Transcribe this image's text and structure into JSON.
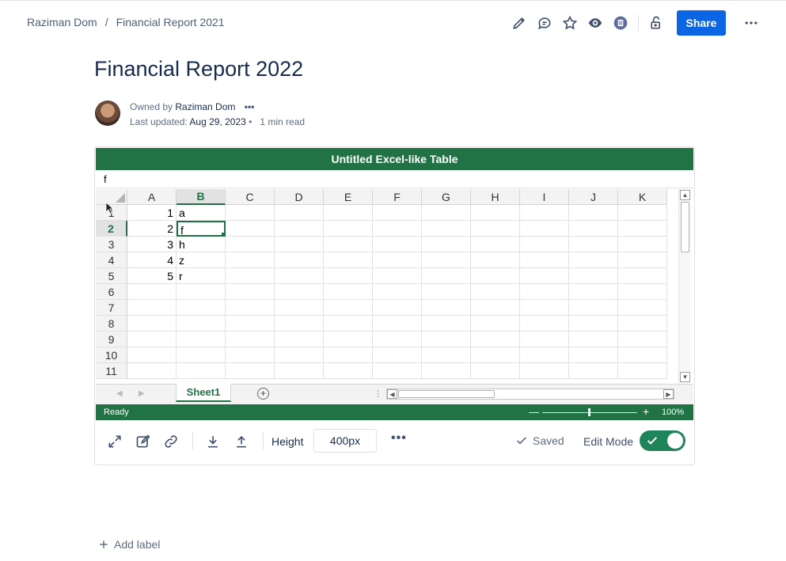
{
  "breadcrumb": {
    "parent": "Raziman Dom",
    "separator": "/",
    "current": "Financial Report 2021"
  },
  "header": {
    "share_label": "Share"
  },
  "page": {
    "title": "Financial Report 2022"
  },
  "byline": {
    "owned_prefix": "Owned by",
    "owner": "Raziman Dom",
    "owner_more": "•••",
    "updated_prefix": "Last updated:",
    "updated_date": "Aug 29, 2023",
    "dot": "•",
    "read_time": "1 min read"
  },
  "spreadsheet": {
    "title": "Untitled Excel-like Table",
    "formula_value": "f",
    "columns": [
      "A",
      "B",
      "C",
      "D",
      "E",
      "F",
      "G",
      "H",
      "I",
      "J",
      "K"
    ],
    "active_column": "B",
    "active_row": 2,
    "rows": [
      {
        "label": "1",
        "cells": [
          "1",
          "a",
          "",
          "",
          "",
          "",
          "",
          "",
          "",
          "",
          ""
        ]
      },
      {
        "label": "2",
        "cells": [
          "2",
          "f",
          "",
          "",
          "",
          "",
          "",
          "",
          "",
          "",
          ""
        ]
      },
      {
        "label": "3",
        "cells": [
          "3",
          "h",
          "",
          "",
          "",
          "",
          "",
          "",
          "",
          "",
          ""
        ]
      },
      {
        "label": "4",
        "cells": [
          "4",
          "z",
          "",
          "",
          "",
          "",
          "",
          "",
          "",
          "",
          ""
        ]
      },
      {
        "label": "5",
        "cells": [
          "5",
          "r",
          "",
          "",
          "",
          "",
          "",
          "",
          "",
          "",
          ""
        ]
      },
      {
        "label": "6",
        "cells": [
          "",
          "",
          "",
          "",
          "",
          "",
          "",
          "",
          "",
          "",
          ""
        ]
      },
      {
        "label": "7",
        "cells": [
          "",
          "",
          "",
          "",
          "",
          "",
          "",
          "",
          "",
          "",
          ""
        ]
      },
      {
        "label": "8",
        "cells": [
          "",
          "",
          "",
          "",
          "",
          "",
          "",
          "",
          "",
          "",
          ""
        ]
      },
      {
        "label": "9",
        "cells": [
          "",
          "",
          "",
          "",
          "",
          "",
          "",
          "",
          "",
          "",
          ""
        ]
      },
      {
        "label": "10",
        "cells": [
          "",
          "",
          "",
          "",
          "",
          "",
          "",
          "",
          "",
          "",
          ""
        ]
      },
      {
        "label": "11",
        "cells": [
          "",
          "",
          "",
          "",
          "",
          "",
          "",
          "",
          "",
          "",
          ""
        ]
      }
    ],
    "sheet_tab": "Sheet1",
    "status": "Ready",
    "zoom_minus": "—",
    "zoom_plus": "+",
    "zoom": "100%"
  },
  "toolbar": {
    "height_label": "Height",
    "height_value": "400px",
    "more": "•••",
    "saved_label": "Saved",
    "edit_mode_label": "Edit Mode",
    "edit_mode_on": true
  },
  "footer": {
    "add_label": "Add label"
  },
  "colors": {
    "excel_green": "#217346",
    "share_blue": "#0c66e4",
    "toggle_green": "#1f845a"
  }
}
